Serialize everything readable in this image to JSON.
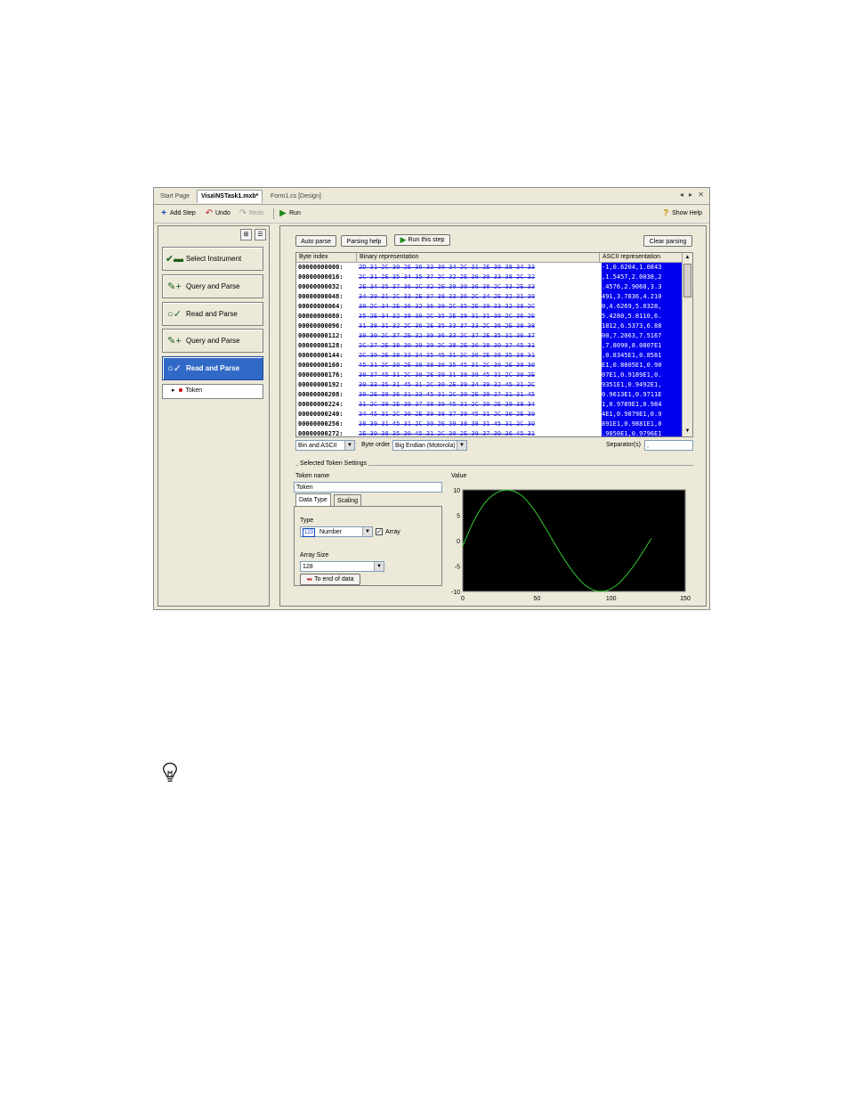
{
  "tabs": {
    "items": [
      "Start Page",
      "Visa\\NSTask1.mxb*",
      "Form1.cs [Design]"
    ],
    "nav": "◂ ▸ ✕"
  },
  "toolbar": {
    "add_step": "Add Step",
    "undo": "Undo",
    "redo": "Redo",
    "run": "Run",
    "show_help": "Show Help"
  },
  "steps": [
    {
      "label": "Select Instrument",
      "icon": "instrument-icon"
    },
    {
      "label": "Query and Parse",
      "icon": "query-parse-icon"
    },
    {
      "label": "Read and Parse",
      "icon": "read-parse-icon"
    },
    {
      "label": "Query and Parse",
      "icon": "query-parse-icon"
    },
    {
      "label": "Read and Parse",
      "icon": "read-parse-icon"
    }
  ],
  "token_tree": {
    "label": "Token"
  },
  "parse_buttons": {
    "auto_parse": "Auto parse",
    "parsing_help": "Parsing help",
    "run_this_step": "Run this step",
    "clear_parsing": "Clear parsing"
  },
  "grid": {
    "headers": [
      "Byte index",
      "Binary representation",
      "ASCII representation"
    ],
    "rows": [
      {
        "idx": "00000000000:",
        "bin": "2D 31 2C 30 2E 36 33 30 34 2C 31 2E 30 38 34 33",
        "asc": "-1,0.6204,1.0843"
      },
      {
        "idx": "00000000016:",
        "bin": "2C 31 2E 35 34 35 37 2C 32 2E 30 30 33 38 2C 32",
        "asc": ",1.5457,2.0038,2"
      },
      {
        "idx": "00000000032:",
        "bin": "2E 34 35 37 36 2C 32 2E 39 30 36 38 2C 33 2E 33",
        "asc": ".4576,2.9068,3.3"
      },
      {
        "idx": "00000000048:",
        "bin": "34 39 31 2C 33 2E 37 38 33 36 2C 34 2E 32 31 30",
        "asc": "491,3.7836,4.210"
      },
      {
        "idx": "00000000064:",
        "bin": "30 2C 34 2E 36 32 36 39 2C 35 2E 30 33 32 38 2C",
        "asc": "0,4.6269,5.0328,"
      },
      {
        "idx": "00000000080:",
        "bin": "35 2E 34 32 38 30 2C 35 2E 38 31 31 30 2C 36 2E",
        "asc": "5.4280,5.8110,6."
      },
      {
        "idx": "00000000096:",
        "bin": "31 38 31 32 2C 36 2E 35 33 37 33 2C 36 2E 38 38",
        "asc": "1812,6.5373,6.88"
      },
      {
        "idx": "00000000112:",
        "bin": "30 30 2C 37 2E 32 30 36 33 2C 37 2E 35 31 36 37",
        "asc": "00,7.2063,7.5167"
      },
      {
        "idx": "00000000128:",
        "bin": "2C 37 2E 38 30 39 30 2C 38 2E 30 38 30 37 45 31",
        "asc": ",7.8090,8.0807E1"
      },
      {
        "idx": "00000000144:",
        "bin": "2C 30 2E 38 33 34 35 45 31 2C 30 2E 38 35 38 31",
        "asc": ",0.8345E1,0.8581"
      },
      {
        "idx": "00000000160:",
        "bin": "45 31 2C 30 2E 38 38 30 35 45 31 2C 30 2E 39 30",
        "asc": "E1,0.8805E1,0.90"
      },
      {
        "idx": "00000000176:",
        "bin": "30 37 45 31 2C 30 2E 39 31 38 39 45 31 2C 30 2E",
        "asc": "07E1,0.9189E1,0."
      },
      {
        "idx": "00000000192:",
        "bin": "39 33 35 31 45 31 2C 30 2E 39 34 39 32 45 31 2C",
        "asc": "9351E1,0.9492E1,"
      },
      {
        "idx": "00000000208:",
        "bin": "30 2E 39 36 31 33 45 31 2C 30 2E 39 37 31 31 45",
        "asc": "0.9613E1,0.9711E"
      },
      {
        "idx": "00000000224:",
        "bin": "31 2C 30 2E 39 37 38 39 45 31 2C 30 2E 39 38 34",
        "asc": "1,0.9789E1,0.984"
      },
      {
        "idx": "00000000240:",
        "bin": "34 45 31 2C 30 2E 39 38 37 39 45 31 2C 30 2E 39",
        "asc": "4E1,0.9879E1,0.9"
      },
      {
        "idx": "00000000256:",
        "bin": "38 39 31 45 31 2C 30 2E 39 38 38 31 45 31 2C 30",
        "asc": "891E1,0.9881E1,0"
      },
      {
        "idx": "00000000272:",
        "bin": "2E 39 38 35 30 45 31 2C 30 2E 39 37 39 36 45 31",
        "asc": ".9850E1,0.9796E1"
      }
    ]
  },
  "format": {
    "view": "Bin and ASCII",
    "byte_order_label": "Byte order",
    "byte_order": "Big Endian (Motorola)",
    "separator_label": "Separator(s)",
    "separator": ","
  },
  "token_settings": {
    "group_label": "Selected Token Settings",
    "token_name_label": "Token name",
    "token_name": "Token",
    "value_label": "Value",
    "tab_data_type": "Data Type",
    "tab_scaling": "Scaling",
    "type_label": "Type",
    "type_badge": "123",
    "type_value": "Number",
    "array_label": "Array",
    "array_checked": "✓",
    "array_size_label": "Array Size",
    "array_size": "128",
    "to_end_label": "To end of data"
  },
  "chart_data": {
    "type": "line",
    "title": "",
    "xlabel": "",
    "ylabel": "",
    "xlim": [
      0,
      150
    ],
    "ylim": [
      -10,
      10
    ],
    "x_ticks": [
      "0",
      "50",
      "100",
      "150"
    ],
    "y_ticks": [
      "10",
      "5",
      "0",
      "-5",
      "-10"
    ],
    "background": "#000000",
    "line_color": "#33cc33",
    "series": [
      {
        "x": [
          0,
          8,
          16,
          24,
          32,
          40,
          48,
          56,
          64,
          72,
          80,
          88,
          96,
          104,
          112,
          120,
          127
        ],
        "values": [
          -1.0,
          4.2,
          7.8,
          9.6,
          9.9,
          8.8,
          6.1,
          2.4,
          -1.6,
          -5.2,
          -8.1,
          -9.7,
          -9.9,
          -8.7,
          -6.2,
          -2.9,
          0.4
        ]
      }
    ]
  },
  "colors": {
    "accent": "#3169c6",
    "selection": "#0000ee",
    "hex_text": "#2a2adf"
  }
}
